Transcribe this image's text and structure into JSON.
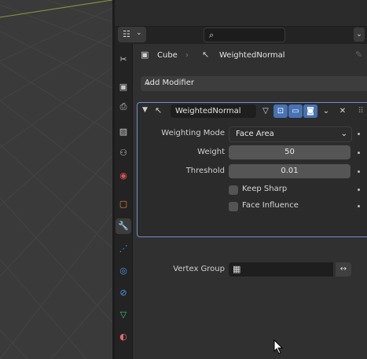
{
  "context": {
    "object_name": "Cube",
    "modifier_name": "WeightedNormal"
  },
  "search": {
    "placeholder": ""
  },
  "add_modifier": {
    "label": "Add Modifier"
  },
  "modifier": {
    "name": "WeightedNormal",
    "weighting_mode": {
      "label": "Weighting Mode",
      "value": "Face Area"
    },
    "weight": {
      "label": "Weight",
      "value": "50"
    },
    "threshold": {
      "label": "Threshold",
      "value": "0.01"
    },
    "keep_sharp": {
      "label": "Keep Sharp",
      "checked": false
    },
    "face_influence": {
      "label": "Face Influence",
      "checked": false
    },
    "vertex_group": {
      "label": "Vertex Group",
      "value": ""
    }
  },
  "tabs": [
    "tool-icon",
    "render-icon",
    "output-icon",
    "view-layer-icon",
    "scene-icon",
    "world-icon",
    "object-icon",
    "modifier-icon",
    "particles-icon",
    "physics-icon",
    "constraints-icon",
    "data-icon",
    "material-icon"
  ],
  "colors": {
    "accent": "#6d8fd1",
    "modifier_tab": "#3c8de0"
  }
}
